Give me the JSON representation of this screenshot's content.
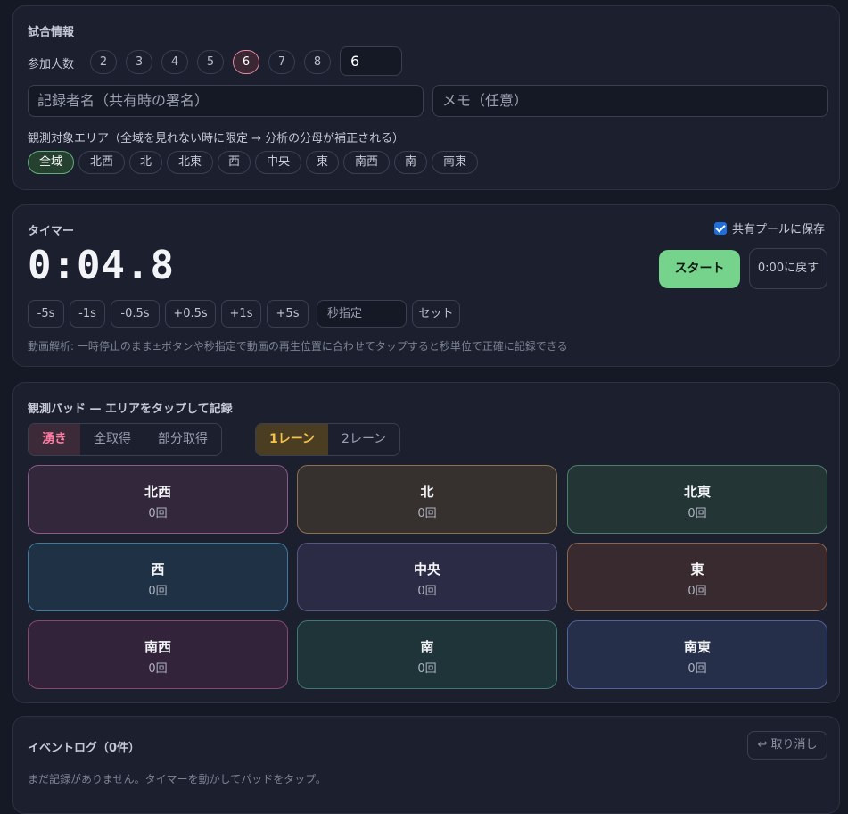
{
  "match": {
    "title": "試合情報",
    "participants_label": "参加人数",
    "participant_options": [
      "2",
      "3",
      "4",
      "5",
      "6",
      "7",
      "8"
    ],
    "participants_selected": "6",
    "participants_value": "6",
    "recorder_placeholder": "記録者名（共有時の署名）",
    "memo_placeholder": "メモ（任意）",
    "area_label": "観測対象エリア（全域を見れない時に限定 → 分析の分母が補正される）",
    "areas": [
      "全域",
      "北西",
      "北",
      "北東",
      "西",
      "中央",
      "東",
      "南西",
      "南",
      "南東"
    ],
    "area_selected": "全域"
  },
  "timer": {
    "title": "タイマー",
    "save_shared_label": "共有プールに保存",
    "save_shared_checked": true,
    "display": "0:04.8",
    "start_label": "スタート",
    "reset_label": "0:00に戻す",
    "steps": [
      "-5s",
      "-1s",
      "-0.5s",
      "+0.5s",
      "+1s",
      "+5s"
    ],
    "seconds_placeholder": "秒指定",
    "set_label": "セット",
    "hint": "動画解析: 一時停止のまま±ボタンや秒指定で動画の再生位置に合わせてタップすると秒単位で正確に記録できる"
  },
  "pad": {
    "title": "観測パッド — エリアをタップして記録",
    "kind_tabs": [
      "湧き",
      "全取得",
      "部分取得"
    ],
    "kind_selected": "湧き",
    "lane_tabs": [
      "1レーン",
      "2レーン"
    ],
    "lane_selected": "1レーン",
    "tiles": [
      {
        "name": "北西",
        "count": "0回"
      },
      {
        "name": "北",
        "count": "0回"
      },
      {
        "name": "北東",
        "count": "0回"
      },
      {
        "name": "西",
        "count": "0回"
      },
      {
        "name": "中央",
        "count": "0回"
      },
      {
        "name": "東",
        "count": "0回"
      },
      {
        "name": "南西",
        "count": "0回"
      },
      {
        "name": "南",
        "count": "0回"
      },
      {
        "name": "南東",
        "count": "0回"
      }
    ],
    "tile_colors": [
      {
        "bg": "#33283b",
        "border": "#8c5a86"
      },
      {
        "bg": "#36302f",
        "border": "#8a7250"
      },
      {
        "bg": "#243536",
        "border": "#4e7d6c"
      },
      {
        "bg": "#1f3245",
        "border": "#3f7a9c"
      },
      {
        "bg": "#2c2b45",
        "border": "#58577e"
      },
      {
        "bg": "#382a2e",
        "border": "#8c6450"
      },
      {
        "bg": "#33233a",
        "border": "#85486f"
      },
      {
        "bg": "#1e3439",
        "border": "#3f7a72"
      },
      {
        "bg": "#262f49",
        "border": "#54619a"
      }
    ]
  },
  "log": {
    "title": "イベントログ（0件）",
    "undo_label": "↩ 取り消し",
    "empty_text": "まだ記録がありません。タイマーを動かしてパッドをタップ。"
  }
}
